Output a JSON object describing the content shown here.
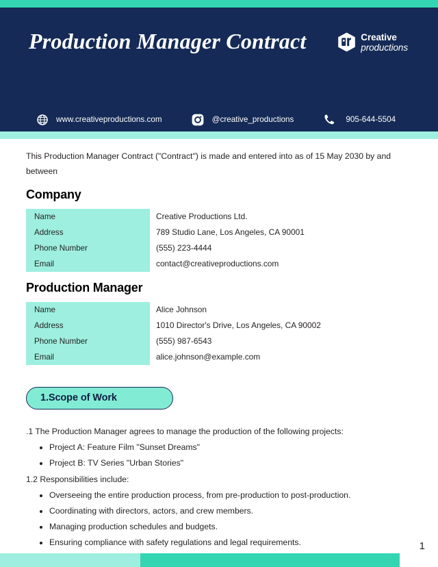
{
  "header": {
    "title": "Production Manager Contract",
    "logo": {
      "icon": "hexagon-ph-logo-icon",
      "line1": "Creative",
      "line2": "productions"
    },
    "contacts": [
      {
        "icon": "globe-icon",
        "text": "www.creativeproductions.com"
      },
      {
        "icon": "instagram-icon",
        "text": "@creative_productions"
      },
      {
        "icon": "phone-icon",
        "text": "905-644-5504"
      }
    ]
  },
  "body": {
    "intro": "This Production Manager Contract (\"Contract\") is made and entered into as of 15 May 2030 by and between",
    "company": {
      "heading": "Company",
      "rows": [
        {
          "label": "Name",
          "value": "Creative Productions Ltd."
        },
        {
          "label": "Address",
          "value": "789 Studio Lane, Los Angeles, CA 90001"
        },
        {
          "label": "Phone Number",
          "value": "(555) 223-4444"
        },
        {
          "label": "Email",
          "value": "contact@creativeproductions.com"
        }
      ]
    },
    "manager": {
      "heading": "Production Manager",
      "rows": [
        {
          "label": "Name",
          "value": "Alice Johnson"
        },
        {
          "label": "Address",
          "value": "1010 Director's Drive, Los Angeles, CA 90002"
        },
        {
          "label": "Phone Number",
          "value": "(555) 987-6543"
        },
        {
          "label": "Email",
          "value": "alice.johnson@example.com"
        }
      ]
    },
    "section1": {
      "pill": "1.Scope of Work",
      "clause_1_1": ".1 The Production Manager agrees to manage the production of the following projects:",
      "projects": [
        "Project A: Feature Film \"Sunset Dreams\"",
        "Project B: TV Series \"Urban Stories\""
      ],
      "clause_1_2": "1.2 Responsibilities include:",
      "responsibilities": [
        "Overseeing the entire production process, from pre-production to post-production.",
        "Coordinating with directors, actors, and crew members.",
        "Managing production schedules and budgets.",
        "Ensuring compliance with safety regulations and legal requirements."
      ]
    }
  },
  "footer": {
    "page_number": "1"
  },
  "colors": {
    "navy": "#152a56",
    "teal_accent": "#34d5b2",
    "teal_light": "#9eefdf",
    "pill_fill": "#81ebd4",
    "text": "#231f20",
    "white": "#ffffff"
  }
}
